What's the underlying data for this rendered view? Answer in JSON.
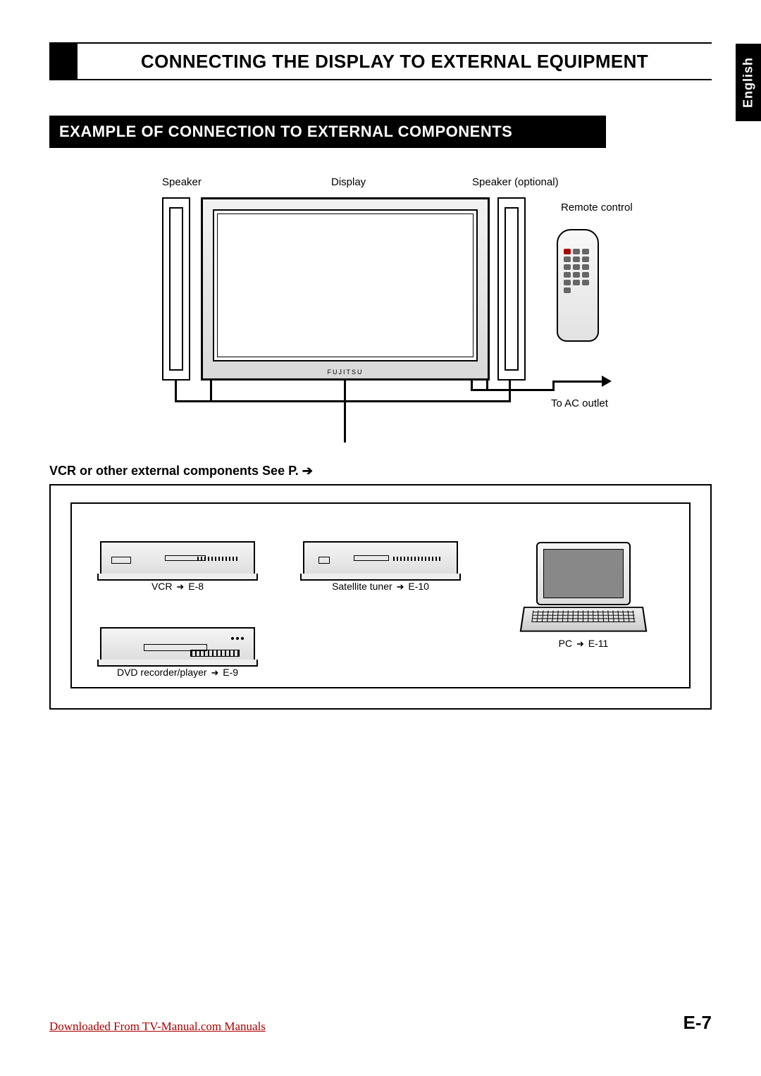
{
  "header": {
    "title": "CONNECTING THE DISPLAY TO EXTERNAL EQUIPMENT",
    "language_tab": "English"
  },
  "section": {
    "title": "EXAMPLE OF CONNECTION TO EXTERNAL COMPONENTS"
  },
  "diagram": {
    "labels": {
      "speaker_left": "Speaker",
      "display": "Display",
      "speaker_right": "Speaker (optional)",
      "remote": "Remote control",
      "ac_outlet": "To AC outlet",
      "brand": "FUJITSU"
    }
  },
  "components": {
    "heading": "VCR or other external components See P. ➔",
    "items": {
      "vcr": {
        "label_prefix": "VCR",
        "page": "E-8"
      },
      "satellite": {
        "label_prefix": "Satellite tuner",
        "page": "E-10"
      },
      "pc": {
        "label_prefix": "PC",
        "page": "E-11"
      },
      "dvd": {
        "label_prefix": "DVD recorder/player",
        "page": "E-9"
      }
    }
  },
  "footer": {
    "download_text": "Downloaded From TV-Manual.com Manuals",
    "page_number": "E-7"
  }
}
